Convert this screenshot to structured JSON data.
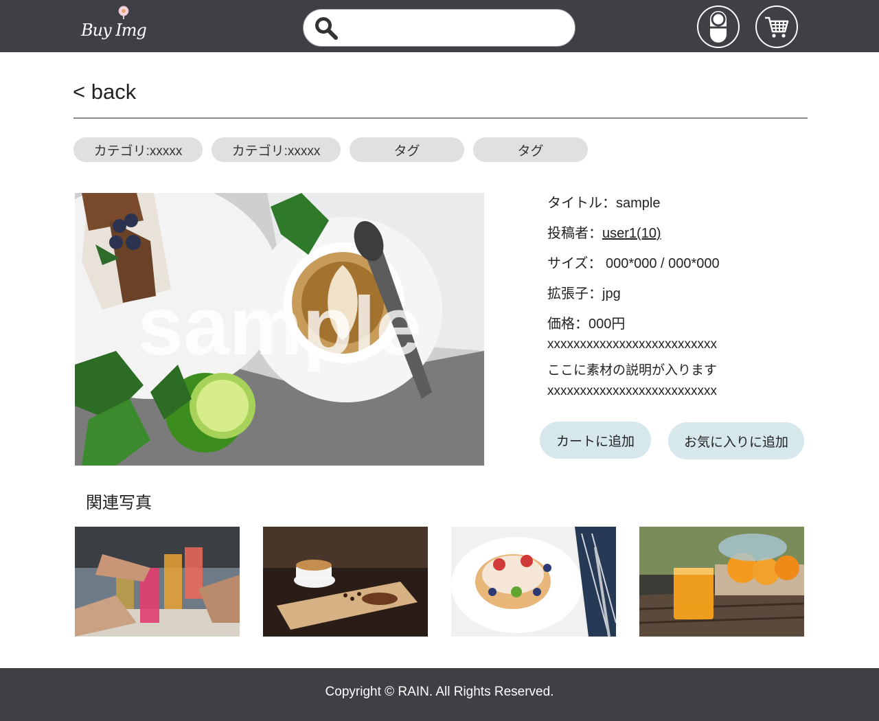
{
  "header": {
    "logo_text": "Buy Img",
    "search": {
      "value": "",
      "placeholder": ""
    },
    "user_icon": "user-account-icon",
    "cart_icon": "shopping-cart-icon"
  },
  "nav": {
    "back_label": "< back"
  },
  "chips": [
    {
      "label": "カテゴリ:xxxxx"
    },
    {
      "label": "カテゴリ:xxxxx"
    },
    {
      "label": "タグ"
    },
    {
      "label": "タグ"
    }
  ],
  "main_image": {
    "watermark": "sample"
  },
  "details": {
    "title_label": "タイトル：",
    "title_value": "sample",
    "poster_label": "投稿者：",
    "poster_value": "user1(10)",
    "size_label": "サイズ：",
    "size_value": " 000*000 / 000*000",
    "ext_label": "拡張子：",
    "ext_value": "jpg",
    "price_label": "価格：",
    "price_value": "000円",
    "desc_line1": "xxxxxxxxxxxxxxxxxxxxxxxxxx",
    "desc_line2": "ここに素材の説明が入ります",
    "desc_line3": "xxxxxxxxxxxxxxxxxxxxxxxxxx"
  },
  "actions": {
    "add_to_cart": "カートに追加",
    "add_to_favorites": "お気に入りに追加"
  },
  "related": {
    "heading": "関連写真",
    "items": [
      {
        "name": "drinks-toast-photo"
      },
      {
        "name": "latte-on-board-photo"
      },
      {
        "name": "pancakes-with-fruit-photo"
      },
      {
        "name": "orange-juice-photo"
      }
    ]
  },
  "footer": {
    "copyright": "Copyright © RAIN. All Rights Reserved."
  },
  "colors": {
    "header_bg": "#3f3f46",
    "chip_bg": "#e0e0e0",
    "action_bg": "#d7e8ec",
    "divider": "#8a8a8a"
  }
}
